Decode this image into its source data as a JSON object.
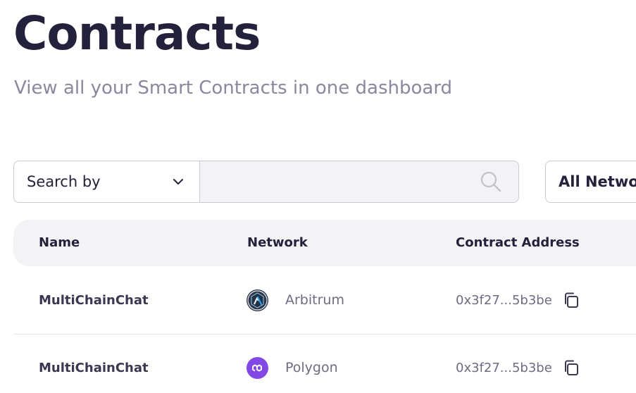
{
  "page": {
    "title": "Contracts",
    "subtitle": "View all your Smart Contracts in one dashboard"
  },
  "filters": {
    "search_by_label": "Search by",
    "search_placeholder": "",
    "search_value": "",
    "network_filter_label": "All Netwo"
  },
  "table": {
    "columns": [
      "Name",
      "Network",
      "Contract Address"
    ],
    "rows": [
      {
        "name": "MultiChainChat",
        "network": "Arbitrum",
        "network_icon": "arbitrum-icon",
        "network_color": "#2d374b",
        "address": "0x3f27...5b3be"
      },
      {
        "name": "MultiChainChat",
        "network": "Polygon",
        "network_icon": "polygon-icon",
        "network_color": "#8247e5",
        "address": "0x3f27...5b3be"
      }
    ]
  },
  "colors": {
    "title": "#23213b",
    "subtitle": "#8a879e",
    "header_bg": "#f3f3f6",
    "border": "#c9c8d3"
  }
}
